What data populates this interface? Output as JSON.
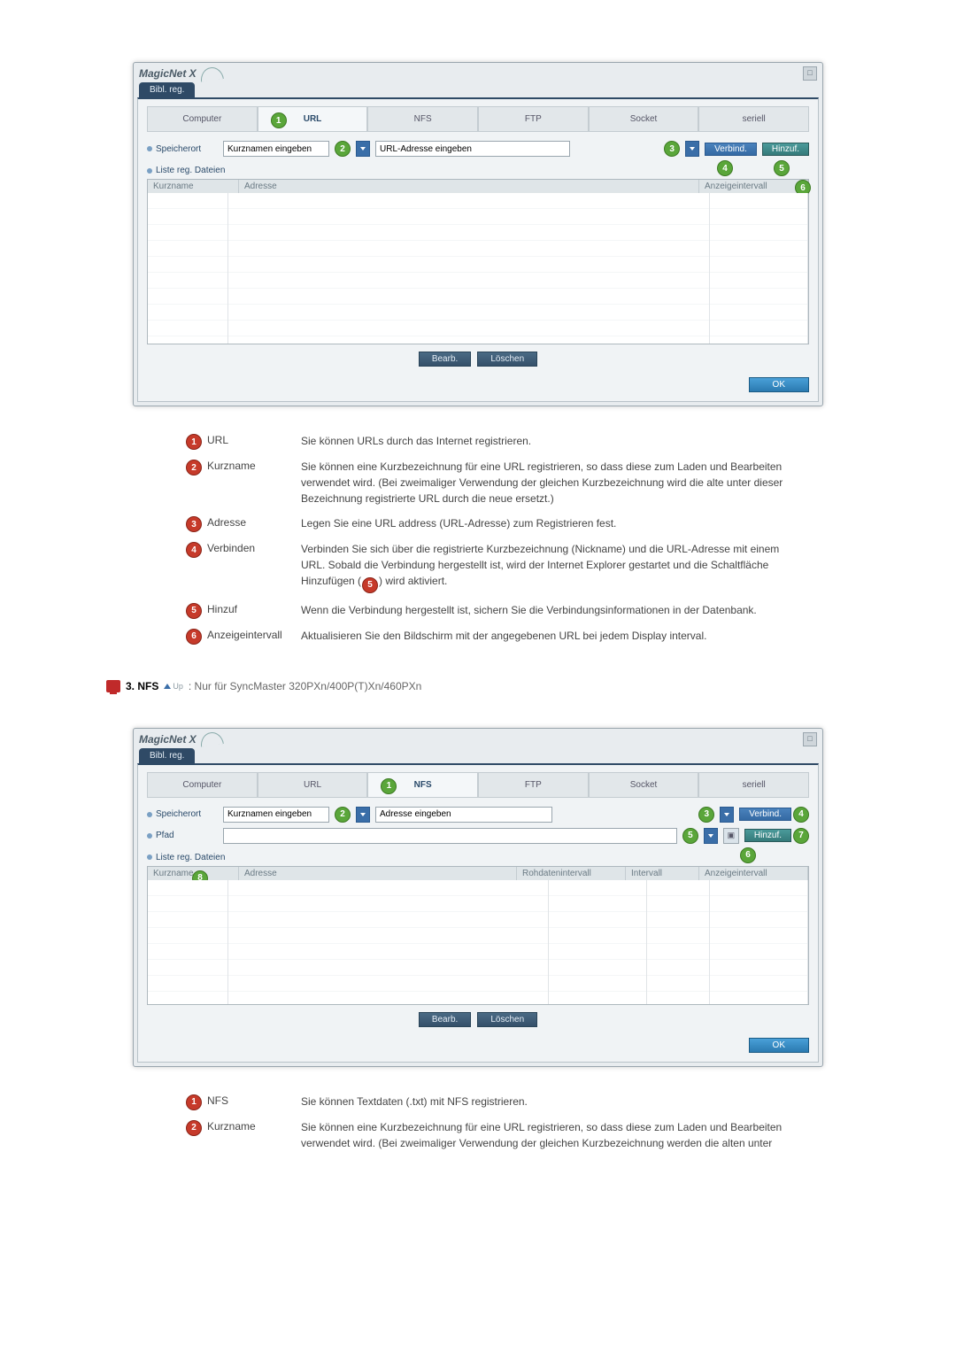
{
  "brand": "MagicNet X",
  "subtab": "Bibl. reg.",
  "protocols": [
    "Computer",
    "URL",
    "NFS",
    "FTP",
    "Socket",
    "seriell"
  ],
  "url_screen": {
    "active_proto": "URL",
    "speicherort_label": "Speicherort",
    "kurzname_placeholder": "Kurznamen eingeben",
    "adresse_placeholder": "URL-Adresse eingeben",
    "verbind_btn": "Verbind.",
    "hinzuf_btn": "Hinzuf.",
    "liste_label": "Liste reg. Dateien",
    "cols": {
      "kurzname": "Kurzname",
      "adresse": "Adresse",
      "anzeige": "Anzeigeintervall"
    },
    "bearb": "Bearb.",
    "loeschen": "Löschen",
    "ok": "OK",
    "badges": {
      "tab": "1",
      "kurz": "2",
      "addr": "3",
      "verbind": "4",
      "hinzuf": "5",
      "anzeige": "6"
    }
  },
  "url_desc": [
    {
      "n": "1",
      "term": "URL",
      "def": "Sie können URLs durch das Internet registrieren."
    },
    {
      "n": "2",
      "term": "Kurzname",
      "def": "Sie können eine Kurzbezeichnung für eine URL registrieren, so dass diese zum Laden und Bearbeiten verwendet wird. (Bei zweimaliger Verwendung der gleichen Kurzbezeichnung wird die alte unter dieser Bezeichnung registrierte URL durch die neue ersetzt.)"
    },
    {
      "n": "3",
      "term": "Adresse",
      "def": "Legen Sie eine URL address (URL-Adresse) zum Registrieren fest."
    },
    {
      "n": "4",
      "term": "Verbinden",
      "def": "Verbinden Sie sich über die registrierte Kurzbezeichnung (Nickname) und die URL-Adresse mit einem URL. Sobald die Verbindung hergestellt ist, wird der Internet Explorer gestartet und die Schaltfläche Hinzufügen (INLINE5) wird aktiviert."
    },
    {
      "n": "5",
      "term": "Hinzuf",
      "def": "Wenn die Verbindung hergestellt ist, sichern Sie die Verbindungsinformationen in der Datenbank."
    },
    {
      "n": "6",
      "term": "Anzeigeintervall",
      "def": "Aktualisieren Sie den Bildschirm mit der angegebenen URL bei jedem Display interval."
    }
  ],
  "nfs_heading": {
    "num": "3.",
    "title": "NFS",
    "up": "Up",
    "note": ": Nur für SyncMaster 320PXn/400P(T)Xn/460PXn"
  },
  "nfs_screen": {
    "active_proto": "NFS",
    "speicherort_label": "Speicherort",
    "kurzname_placeholder": "Kurznamen eingeben",
    "adresse_placeholder": "Adresse eingeben",
    "pfad_label": "Pfad",
    "verbind_btn": "Verbind.",
    "hinzuf_btn": "Hinzuf.",
    "liste_label": "Liste reg. Dateien",
    "cols": {
      "kurzname": "Kurzname",
      "adresse": "Adresse",
      "rohdaten": "Rohdatenintervall",
      "intervall": "Intervall",
      "anzeige": "Anzeigeintervall"
    },
    "bearb": "Bearb.",
    "loeschen": "Löschen",
    "ok": "OK",
    "badges": {
      "tab": "1",
      "kurz": "2",
      "addr": "3",
      "verbind": "4",
      "pfaddd": "5",
      "pfadicon": "6",
      "hinzuf": "7",
      "kurzcol": "8"
    }
  },
  "nfs_desc": [
    {
      "n": "1",
      "term": "NFS",
      "def": "Sie können Textdaten (.txt) mit NFS registrieren."
    },
    {
      "n": "2",
      "term": "Kurzname",
      "def": "Sie können eine Kurzbezeichnung für eine URL registrieren, so dass diese zum Laden und Bearbeiten verwendet wird. (Bei zweimaliger Verwendung der gleichen Kurzbezeichnung werden die alten unter"
    }
  ]
}
